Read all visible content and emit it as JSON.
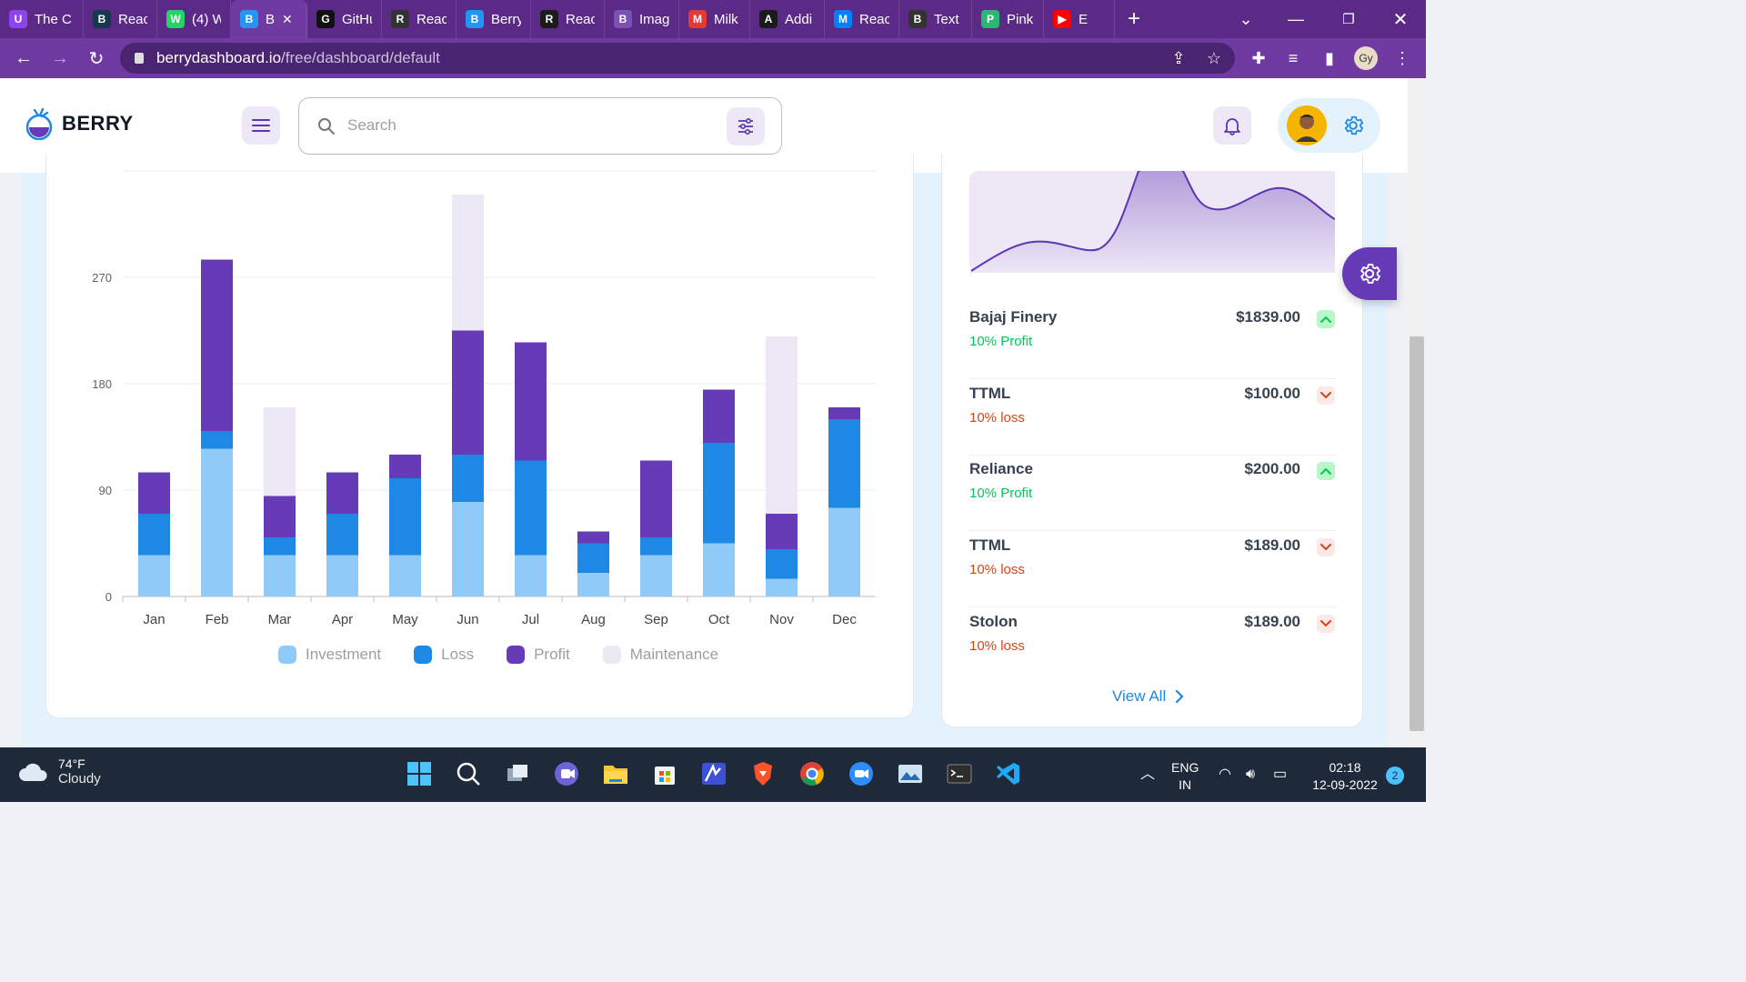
{
  "browser": {
    "tabs": [
      {
        "label": "The C",
        "icon": "u-icon",
        "color": "#8e44ec",
        "glyph": "U"
      },
      {
        "label": "React",
        "icon": "react-bootstrap-icon",
        "color": "#17394d",
        "glyph": "B"
      },
      {
        "label": "(4) W",
        "icon": "whatsapp-icon",
        "color": "#25d366",
        "glyph": "W"
      },
      {
        "label": "B",
        "icon": "berry-icon",
        "color": "#2196f3",
        "glyph": "B",
        "active": true
      },
      {
        "label": "GitHu",
        "icon": "github-icon",
        "color": "#111111",
        "glyph": "G"
      },
      {
        "label": "React",
        "icon": "globe-icon",
        "color": "#333333",
        "glyph": "R"
      },
      {
        "label": "Berry",
        "icon": "berry-icon",
        "color": "#2196f3",
        "glyph": "B"
      },
      {
        "label": "React",
        "icon": "react-icon",
        "color": "#1b1b1b",
        "glyph": "R"
      },
      {
        "label": "Imag",
        "icon": "bootstrap-icon",
        "color": "#7952b3",
        "glyph": "B"
      },
      {
        "label": "Milk",
        "icon": "flame-icon",
        "color": "#e53935",
        "glyph": "M"
      },
      {
        "label": "Addi",
        "icon": "react-icon",
        "color": "#1b1b1b",
        "glyph": "A"
      },
      {
        "label": "React",
        "icon": "mui-icon",
        "color": "#007fff",
        "glyph": "M"
      },
      {
        "label": "Text",
        "icon": "bootstrap-icon",
        "color": "#333333",
        "glyph": "B"
      },
      {
        "label": "Pink",
        "icon": "p-icon",
        "color": "#2bb673",
        "glyph": "P"
      },
      {
        "label": "E",
        "icon": "youtube-icon",
        "color": "#ff0000",
        "glyph": "▶"
      }
    ],
    "url_host": "berrydashboard.io",
    "url_path": "/free/dashboard/default",
    "profile_initials": "Gy"
  },
  "app": {
    "logo_text": "BERRY",
    "search_placeholder": "Search"
  },
  "chart_data": {
    "type": "bar",
    "stacked": true,
    "categories": [
      "Jan",
      "Feb",
      "Mar",
      "Apr",
      "May",
      "Jun",
      "Jul",
      "Aug",
      "Sep",
      "Oct",
      "Nov",
      "Dec"
    ],
    "series": [
      {
        "name": "Investment",
        "color": "#90caf9",
        "values": [
          35,
          125,
          35,
          35,
          35,
          80,
          35,
          20,
          35,
          45,
          15,
          75
        ]
      },
      {
        "name": "Loss",
        "color": "#1e88e5",
        "values": [
          35,
          15,
          15,
          35,
          65,
          40,
          80,
          25,
          15,
          85,
          25,
          75
        ]
      },
      {
        "name": "Profit",
        "color": "#673ab7",
        "values": [
          35,
          145,
          35,
          35,
          20,
          105,
          100,
          10,
          65,
          45,
          30,
          10
        ]
      },
      {
        "name": "Maintenance",
        "color": "#ede7f6",
        "values": [
          0,
          0,
          75,
          0,
          0,
          115,
          0,
          0,
          0,
          0,
          150,
          0
        ]
      }
    ],
    "ytick_labels": [
      "0",
      "90",
      "180",
      "270"
    ],
    "ylim": [
      0,
      360
    ],
    "legend": "bottom",
    "grid": true
  },
  "stocks": [
    {
      "name": "Bajaj Finery",
      "price": "$1839.00",
      "change": "10% Profit",
      "trend": "up"
    },
    {
      "name": "TTML",
      "price": "$100.00",
      "change": "10% loss",
      "trend": "down"
    },
    {
      "name": "Reliance",
      "price": "$200.00",
      "change": "10% Profit",
      "trend": "up"
    },
    {
      "name": "TTML",
      "price": "$189.00",
      "change": "10% loss",
      "trend": "down"
    },
    {
      "name": "Stolon",
      "price": "$189.00",
      "change": "10% loss",
      "trend": "down"
    }
  ],
  "view_all_label": "View All",
  "colors": {
    "profit": "#00c853",
    "loss": "#d84315",
    "primary": "#673ab7",
    "secondary": "#1e88e5"
  },
  "taskbar": {
    "weather_temp": "74°F",
    "weather_desc": "Cloudy",
    "lang_1": "ENG",
    "lang_2": "IN",
    "time": "02:18",
    "date": "12-09-2022",
    "notification_count": "2"
  }
}
